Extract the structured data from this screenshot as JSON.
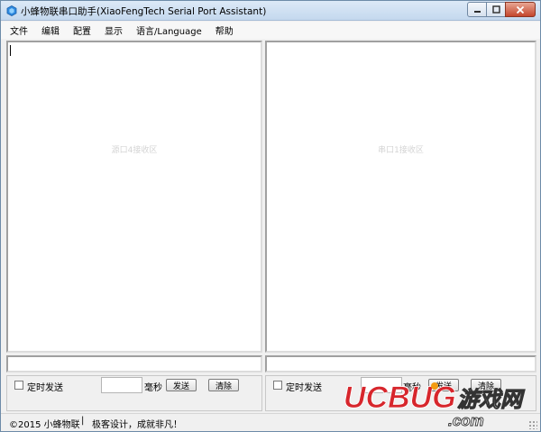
{
  "window": {
    "title": "小蜂物联串口助手(XiaoFengTech Serial Port Assistant)"
  },
  "menu": {
    "items": [
      "文件",
      "编辑",
      "配置",
      "显示",
      "语言/Language",
      "帮助"
    ]
  },
  "panes": {
    "left_placeholder": "源口4接收区",
    "right_placeholder": "串口1接收区"
  },
  "send_left": {
    "checkbox_label": "定时发送",
    "unit": "毫秒",
    "send_label": "发送",
    "clear_label": "清除"
  },
  "send_right": {
    "checkbox_label": "定时发送",
    "unit": "毫秒",
    "send_label": "发送",
    "clear_label": "清除"
  },
  "status": {
    "copyright": "©2015 小蜂物联",
    "separator": "|",
    "slogan": "极客设计，成就非凡！"
  },
  "watermark": {
    "brand": "UCBUG",
    "cn": "游戏网",
    "domain": ".com"
  },
  "colors": {
    "watermark_red": "#d7262c",
    "watermark_orange": "#f39c12"
  }
}
